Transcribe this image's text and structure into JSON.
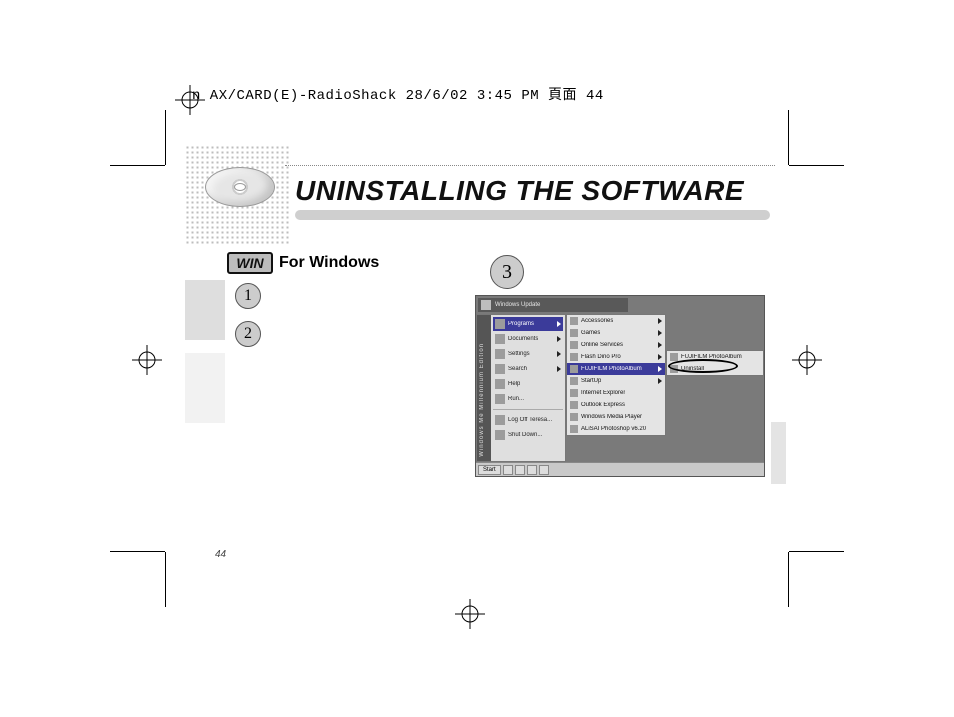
{
  "slug": "n AX/CARD(E)-RadioShack  28/6/02  3:45 PM  頁面 44",
  "title": "UNINSTALLING THE SOFTWARE",
  "win_badge": {
    "code": "WIN",
    "label": "For Windows"
  },
  "steps": {
    "s1": "1",
    "s2": "2",
    "s3": "3"
  },
  "page_number": "44",
  "screenshot": {
    "topbar": "Windows Update",
    "vstrip": "Windows Me Millennium Edition",
    "start_items": [
      {
        "label": "Programs",
        "sel": true,
        "arrow": true
      },
      {
        "label": "Documents",
        "arrow": true
      },
      {
        "label": "Settings",
        "arrow": true
      },
      {
        "label": "Search",
        "arrow": true
      },
      {
        "label": "Help"
      },
      {
        "label": "Run..."
      }
    ],
    "start_items2": [
      {
        "label": "Log Off Teresa..."
      },
      {
        "label": "Shut Down..."
      }
    ],
    "submenu": [
      {
        "label": "Accessories",
        "arrow": true
      },
      {
        "label": "Games",
        "arrow": true
      },
      {
        "label": "Online Services",
        "arrow": true
      },
      {
        "label": "Flash Dino Pro",
        "arrow": true
      },
      {
        "label": "FUJIFILM PhotoAlbum",
        "sel": true,
        "arrow": true
      },
      {
        "label": "StartUp",
        "arrow": true
      },
      {
        "label": "Internet Explorer"
      },
      {
        "label": "Outlook Express"
      },
      {
        "label": "Windows Media Player"
      },
      {
        "label": "ALiSAI Photoshop v6.20"
      }
    ],
    "submenu2": [
      {
        "label": "FUJIFILM PhotoAlbum"
      },
      {
        "label": "Uninstall"
      }
    ],
    "taskbar_start": "Start"
  }
}
